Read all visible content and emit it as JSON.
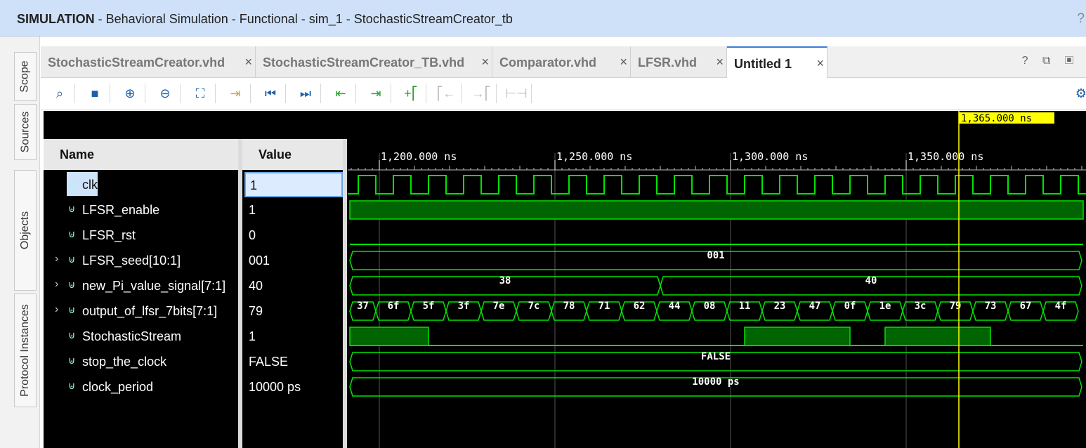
{
  "titlebar": {
    "mode": "SIMULATION",
    "context": " - Behavioral Simulation - Functional - sim_1 - StochasticStreamCreator_tb",
    "help": "?"
  },
  "side_tabs": [
    "Scope",
    "Sources",
    "Objects",
    "Protocol Instances"
  ],
  "tabs": [
    {
      "label": "StochasticStreamCreator.vhd",
      "close": "×"
    },
    {
      "label": "StochasticStreamCreator_TB.vhd",
      "close": "×"
    },
    {
      "label": "Comparator.vhd",
      "close": "×"
    },
    {
      "label": "LFSR.vhd",
      "close": "×"
    },
    {
      "label": "Untitled 1",
      "close": "×"
    }
  ],
  "tab_tools": "? ⧉ ▣",
  "toolbar_icons": [
    "search-icon",
    "save-icon",
    "zoom-in-icon",
    "zoom-out-icon",
    "zoom-fit-icon",
    "go-to-cursor-icon",
    "go-to-time-0-icon",
    "go-to-last-time-icon",
    "previous-transition-icon",
    "next-transition-icon",
    "add-marker-icon",
    "previous-marker-icon",
    "next-marker-icon",
    "swap-cursors-icon",
    "settings-icon"
  ],
  "columns": {
    "name": "Name",
    "value": "Value"
  },
  "signals": [
    {
      "name": "clk",
      "value": "1",
      "icon": "bit-signal-icon",
      "expandable": false
    },
    {
      "name": "LFSR_enable",
      "value": "1",
      "icon": "bit-signal-icon",
      "expandable": false
    },
    {
      "name": "LFSR_rst",
      "value": "0",
      "icon": "bit-signal-icon",
      "expandable": false
    },
    {
      "name": "LFSR_seed[10:1]",
      "value": "001",
      "icon": "bus-signal-icon",
      "expandable": true
    },
    {
      "name": "new_Pi_value_signal[7:1]",
      "value": "40",
      "icon": "bus-signal-icon",
      "expandable": true
    },
    {
      "name": "output_of_lfsr_7bits[7:1]",
      "value": "79",
      "icon": "bus-signal-icon",
      "expandable": true
    },
    {
      "name": "StochasticStream",
      "value": "1",
      "icon": "bit-signal-icon",
      "expandable": false
    },
    {
      "name": "stop_the_clock",
      "value": "FALSE",
      "icon": "bit-signal-icon",
      "expandable": false
    },
    {
      "name": "clock_period",
      "value": "10000 ps",
      "icon": "bit-signal-icon",
      "expandable": false
    }
  ],
  "waveform": {
    "cursor_label": "1,365.000 ns",
    "cursor_time_ns": 1365,
    "time_start_ns": 1190,
    "time_end_ns": 1399,
    "ticks": [
      {
        "t": 1200,
        "label": "1,200.000 ns"
      },
      {
        "t": 1250,
        "label": "1,250.000 ns"
      },
      {
        "t": 1300,
        "label": "1,300.000 ns"
      },
      {
        "t": 1350,
        "label": "1,350.000 ns"
      }
    ],
    "clk_period_ns": 10,
    "clk_first_rise_ns": 1194,
    "lfsr_seed": "001",
    "pi_values": [
      {
        "from": 1190,
        "to": 1280,
        "label": "38"
      },
      {
        "from": 1280,
        "to": 1400,
        "label": "40"
      }
    ],
    "lfsr_values": [
      "37",
      "6f",
      "5f",
      "3f",
      "7e",
      "7c",
      "78",
      "71",
      "62",
      "44",
      "08",
      "11",
      "23",
      "47",
      "0f",
      "1e",
      "3c",
      "79",
      "73",
      "67",
      "4f"
    ],
    "lfsr_first_change_ns": 1199,
    "stream_high_intervals": [
      [
        1190,
        1214
      ],
      [
        1304,
        1334
      ],
      [
        1344,
        1374
      ]
    ],
    "stop_the_clock": "FALSE",
    "clock_period": "10000 ps",
    "colors": {
      "wave": "#00e400",
      "fill": "#006400",
      "cursor": "#ffff00",
      "grid": "#555555"
    }
  }
}
